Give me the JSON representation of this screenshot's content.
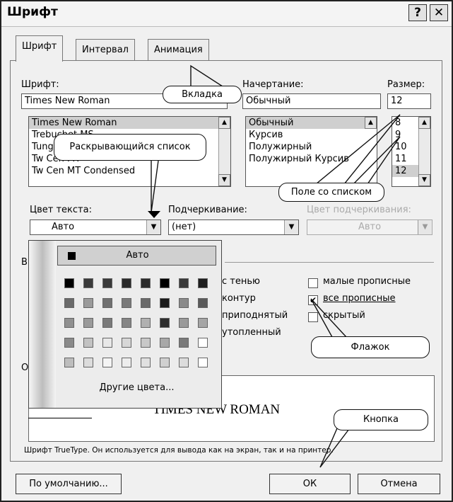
{
  "window": {
    "title": "Шрифт",
    "help_btn": "?",
    "close_btn": "✕"
  },
  "tabs": [
    {
      "label": "Шрифт"
    },
    {
      "label": "Интервал"
    },
    {
      "label": "Анимация"
    }
  ],
  "font": {
    "label": "Шрифт:",
    "value": "Times New Roman",
    "items": [
      "Times New Roman",
      "Trebuchet MS",
      "Tunga",
      "Tw Cen MT",
      "Tw Cen MT Condensed"
    ]
  },
  "style": {
    "label": "Начертание:",
    "value": "Обычный",
    "items": [
      "Обычный",
      "Курсив",
      "Полужирный",
      "Полужирный Курсив"
    ]
  },
  "size": {
    "label": "Размер:",
    "value": "12",
    "items": [
      "8",
      "9",
      "10",
      "11",
      "12"
    ]
  },
  "color": {
    "label": "Цвет текста:",
    "value": "Авто"
  },
  "underline": {
    "label": "Подчеркивание:",
    "value": "(нет)"
  },
  "underline_color": {
    "label": "Цвет подчеркивания:",
    "value": "Авто"
  },
  "effects": {
    "group_label_prefix": "В",
    "left": [
      "с тенью",
      "контур",
      "приподнятый",
      "утопленный"
    ],
    "right": [
      {
        "label": "малые прописные",
        "checked": false
      },
      {
        "label": "все прописные",
        "checked": true
      },
      {
        "label": "скрытый",
        "checked": false
      }
    ]
  },
  "preview": {
    "group_label_prefix": "О",
    "sample": "TIMES NEW ROMAN",
    "note": "Шрифт TrueType. Он используется для вывода как на экран, так и на принтер."
  },
  "palette": {
    "auto_label": "Авто",
    "more_label": "Другие цвета...",
    "rows": [
      [
        "#000000",
        "#3a3a3a",
        "#3a3a3a",
        "#2b2b2b",
        "#2b2b2b",
        "#000000",
        "#3a3a3a",
        "#1e1e1e"
      ],
      [
        "#6a6a6a",
        "#9a9a9a",
        "#707070",
        "#7a7a7a",
        "#6a6a6a",
        "#1a1a1a",
        "#8a8a8a",
        "#5a5a5a"
      ],
      [
        "#909090",
        "#9a9a9a",
        "#7a7a7a",
        "#858585",
        "#b0b0b0",
        "#2e2e2e",
        "#9a9a9a",
        "#a5a5a5"
      ],
      [
        "#8a8a8a",
        "#c2c2c2",
        "#e8e8e8",
        "#d7d7d7",
        "#c8c8c8",
        "#a8a8a8",
        "#7a7a7a",
        "#ffffff"
      ],
      [
        "#bdbdbd",
        "#dcdcdc",
        "#f4f4f4",
        "#ededed",
        "#e0e0e0",
        "#d0d0d0",
        "#dcdcdc",
        "#ffffff"
      ]
    ]
  },
  "buttons": {
    "default": "По умолчанию...",
    "ok": "ОК",
    "cancel": "Отмена"
  },
  "callouts": {
    "tab": "Вкладка",
    "dropdown": "Раскрывающийся список",
    "combo": "Поле со списком",
    "checkbox": "Флажок",
    "button": "Кнопка"
  }
}
